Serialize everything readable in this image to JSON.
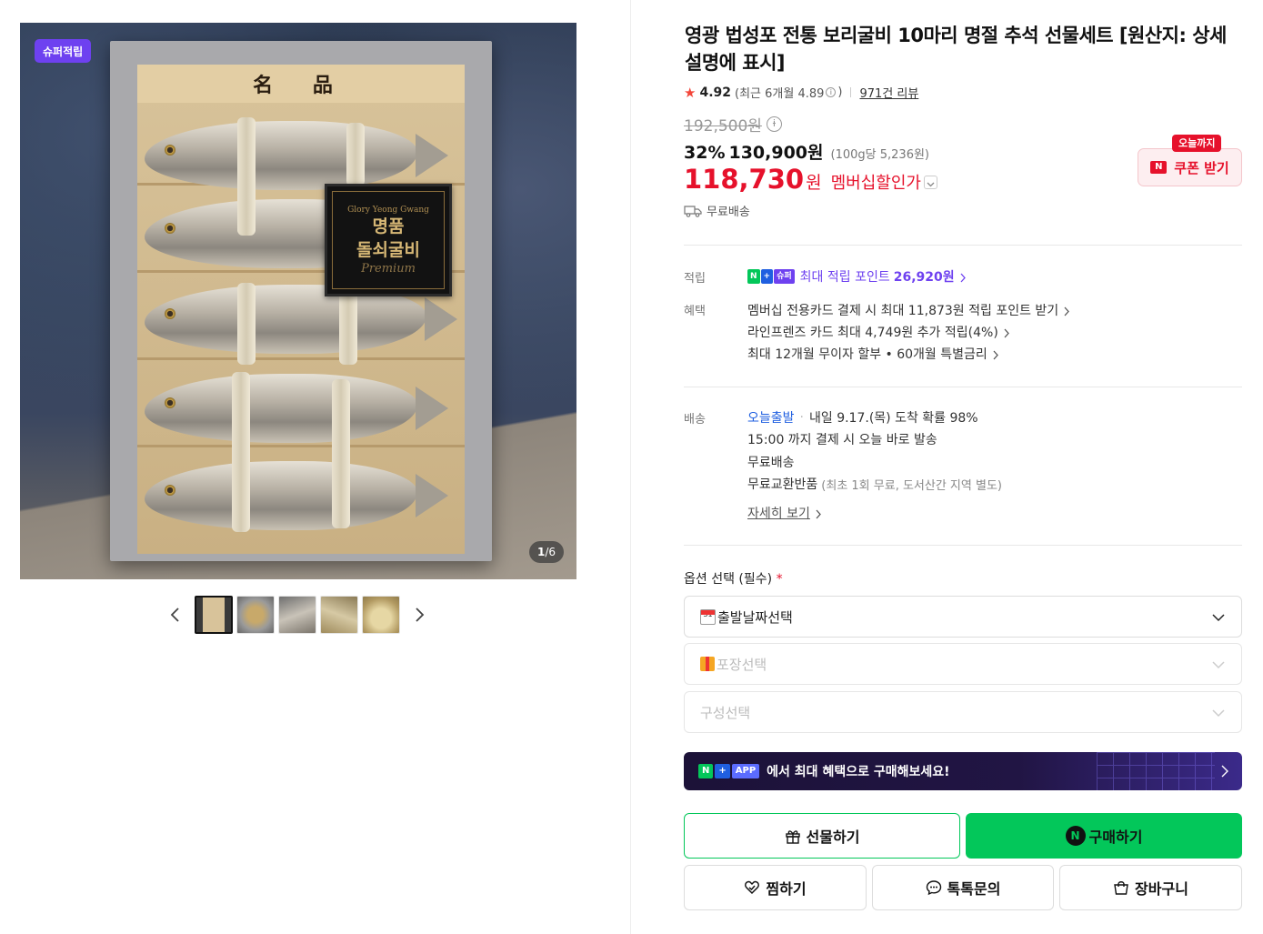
{
  "gallery": {
    "badge": "슈퍼적립",
    "box_header": "名 品",
    "label_top": "Glory Yeong Gwang",
    "label_line1": "명품",
    "label_line2": "돌쇠굴비",
    "label_script": "Premium",
    "counter_current": "1",
    "counter_total": "/6",
    "thumbnails": [
      "thumb-1",
      "thumb-2",
      "thumb-3",
      "thumb-4",
      "thumb-5"
    ]
  },
  "product": {
    "title": "영광 법성포 전통 보리굴비 10마리 명절 추석 선물세트 [원산지: 상세설명에 표시]",
    "rating": "4.92",
    "rating_recent_prefix": "(최근 6개월 4.89",
    "rating_recent_suffix": ")",
    "review_link": "971건 리뷰",
    "original_price": "192,500원",
    "discount_pct": "32%",
    "discount_price": "130,900원",
    "unit_price": "(100g당 5,236원)",
    "member_price": "118,730",
    "member_won": "원",
    "member_label": "멤버십할인가",
    "shipping_free": "무료배송",
    "coupon_tag": "오늘까지",
    "coupon_button": "쿠폰 받기"
  },
  "points": {
    "label": "적립",
    "chip_n": "N",
    "chip_plus": "+",
    "chip_super": "슈퍼",
    "text": "최대 적립 포인트",
    "amount": "26,920원"
  },
  "benefits": {
    "label": "혜택",
    "items": [
      "멤버십 전용카드 결제 시 최대 11,873원 적립 포인트 받기",
      "라인프렌즈 카드 최대 4,749원 추가 적립(4%)",
      "최대 12개월 무이자 할부 • 60개월 특별금리"
    ]
  },
  "delivery": {
    "label": "배송",
    "today_ship": "오늘출발",
    "arrival": "내일 9.17.(목) 도착 확률 98%",
    "cutoff": "15:00 까지 결제 시 오늘 바로 발송",
    "free": "무료배송",
    "return_main": "무료교환반품",
    "return_note": "(최초 1회 무료, 도서산간 지역 별도)",
    "details_link": "자세히 보기"
  },
  "options": {
    "title": "옵션 선택 (필수)",
    "required_mark": "*",
    "date_select": "출발날짜선택",
    "date_icon_text": "31",
    "package_select": "포장선택",
    "composition_select": "구성선택"
  },
  "app_banner": {
    "chip_n": "N",
    "chip_plus": "+",
    "chip_app": "APP",
    "text": "에서 최대 혜택으로 구매해보세요!"
  },
  "actions": {
    "gift": "선물하기",
    "buy": "구매하기",
    "buy_icon": "N",
    "wish": "찜하기",
    "talk": "톡톡문의",
    "cart": "장바구니"
  },
  "colors": {
    "accent_green": "#03c75a",
    "sale_red": "#e6112b",
    "super_purple": "#6e41f0"
  }
}
